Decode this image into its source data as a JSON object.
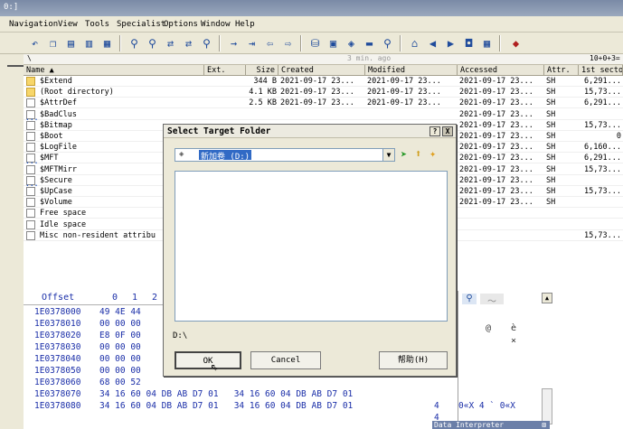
{
  "window": {
    "title": "0:]"
  },
  "menu": [
    "Navigation",
    "View",
    "Tools",
    "Specialist",
    "Options",
    "Window",
    "Help"
  ],
  "pathbar": {
    "path": "\\",
    "age": "3 min. ago",
    "count": "10+0+3="
  },
  "columns": [
    "Name ▲",
    "Ext.",
    "Size",
    "Created",
    "Modified",
    "Accessed",
    "Attr.",
    "1st secto"
  ],
  "files": [
    {
      "name": "$Extend",
      "ext": "",
      "size": "344 B",
      "created": "2021-09-17  23...",
      "modified": "2021-09-17  23...",
      "accessed": "2021-09-17  23...",
      "attr": "SH",
      "sector": "6,291...",
      "icon": "folder"
    },
    {
      "name": "(Root directory)",
      "ext": "",
      "size": "4.1 KB",
      "created": "2021-09-17  23...",
      "modified": "2021-09-17  23...",
      "accessed": "2021-09-17  23...",
      "attr": "SH",
      "sector": "15,73...",
      "icon": "folder"
    },
    {
      "name": "$AttrDef",
      "ext": "",
      "size": "2.5 KB",
      "created": "2021-09-17  23...",
      "modified": "2021-09-17  23...",
      "accessed": "2021-09-17  23...",
      "attr": "SH",
      "sector": "6,291...",
      "icon": "file"
    },
    {
      "name": "$BadClus",
      "ext": "",
      "size": "",
      "created": "",
      "modified": "",
      "accessed": "2021-09-17  23...",
      "attr": "SH",
      "sector": "",
      "icon": "dots"
    },
    {
      "name": "$Bitmap",
      "ext": "",
      "size": "",
      "created": "",
      "modified": "",
      "accessed": "2021-09-17  23...",
      "attr": "SH",
      "sector": "15,73...",
      "icon": "file"
    },
    {
      "name": "$Boot",
      "ext": "",
      "size": "",
      "created": "",
      "modified": "",
      "accessed": "2021-09-17  23...",
      "attr": "SH",
      "sector": "0",
      "icon": "file"
    },
    {
      "name": "$LogFile",
      "ext": "",
      "size": "",
      "created": "",
      "modified": "",
      "accessed": "2021-09-17  23...",
      "attr": "SH",
      "sector": "6,160...",
      "icon": "file"
    },
    {
      "name": "$MFT",
      "ext": "",
      "size": "",
      "created": "",
      "modified": "",
      "accessed": "2021-09-17  23...",
      "attr": "SH",
      "sector": "6,291...",
      "icon": "dots"
    },
    {
      "name": "$MFTMirr",
      "ext": "",
      "size": "",
      "created": "",
      "modified": "",
      "accessed": "2021-09-17  23...",
      "attr": "SH",
      "sector": "15,73...",
      "icon": "file"
    },
    {
      "name": "$Secure",
      "ext": "",
      "size": "",
      "created": "",
      "modified": "",
      "accessed": "2021-09-17  23...",
      "attr": "SH",
      "sector": "",
      "icon": "dots"
    },
    {
      "name": "$UpCase",
      "ext": "",
      "size": "",
      "created": "",
      "modified": "",
      "accessed": "2021-09-17  23...",
      "attr": "SH",
      "sector": "15,73...",
      "icon": "file"
    },
    {
      "name": "$Volume",
      "ext": "",
      "size": "",
      "created": "",
      "modified": "",
      "accessed": "2021-09-17  23...",
      "attr": "SH",
      "sector": "",
      "icon": "file"
    },
    {
      "name": "Free space",
      "ext": "",
      "size": "",
      "created": "",
      "modified": "",
      "accessed": "",
      "attr": "",
      "sector": "",
      "icon": "file"
    },
    {
      "name": "Idle space",
      "ext": "",
      "size": "",
      "created": "",
      "modified": "",
      "accessed": "",
      "attr": "",
      "sector": "",
      "icon": "file"
    },
    {
      "name": "Misc non-resident attribu",
      "ext": "",
      "size": "",
      "created": "",
      "modified": "",
      "accessed": "",
      "attr": "",
      "sector": "15,73...",
      "icon": "file"
    }
  ],
  "hex": {
    "header": [
      "Offset",
      "0",
      "1",
      "2"
    ],
    "rows": [
      {
        "offset": "1E0378000",
        "bytes": "49 4E 44"
      },
      {
        "offset": "1E0378010",
        "bytes": "00 00 00"
      },
      {
        "offset": "1E0378020",
        "bytes": "E8 0F 00"
      },
      {
        "offset": "1E0378030",
        "bytes": "00 00 00"
      },
      {
        "offset": "1E0378040",
        "bytes": "00 00 00"
      },
      {
        "offset": "1E0378050",
        "bytes": "00 00 00"
      },
      {
        "offset": "1E0378060",
        "bytes": "68 00 52"
      },
      {
        "offset": "1E0378070",
        "bytes": "34 16 60 04 DB AB D7 01   34 16 60 04 DB AB D7 01"
      },
      {
        "offset": "1E0378080",
        "bytes": "34 16 60 04 DB AB D7 01   34 16 60 04 DB AB D7 01"
      }
    ],
    "ascii": [
      "4",
      "4"
    ],
    "chars_row7": "0«X 4 ` 0«X",
    "side_chars": [
      "@",
      "è",
      "×"
    ]
  },
  "dialog": {
    "title": "Select Target Folder",
    "help_btn": "?",
    "close_btn": "X",
    "drive": "新加卷 (D:)",
    "path": "D:\\",
    "ok": "OK",
    "cancel": "Cancel",
    "help": "帮助(H)"
  },
  "data_interpreter": "Data Interpreter"
}
